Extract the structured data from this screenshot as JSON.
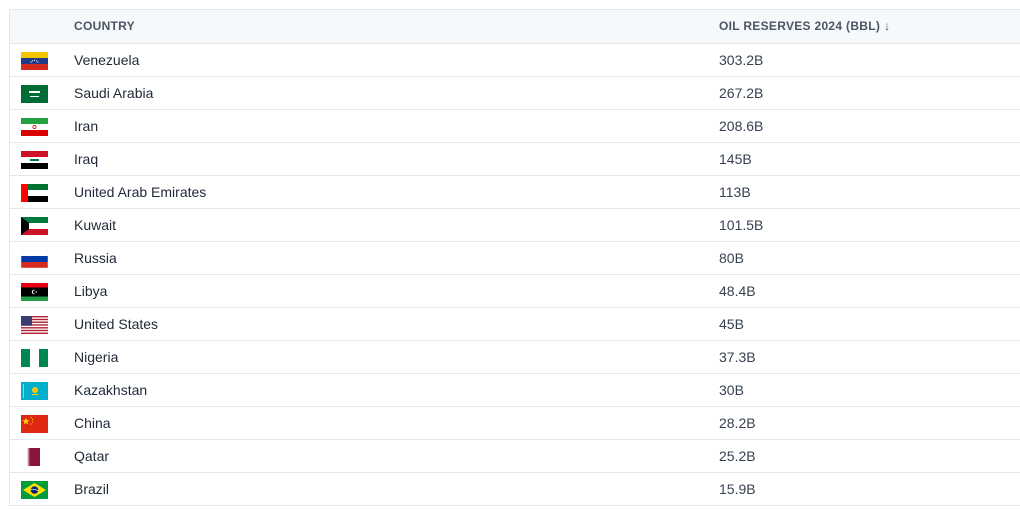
{
  "table": {
    "headers": {
      "country": "COUNTRY",
      "oil_reserves": "OIL RESERVES 2024 (BBL)",
      "sort_icon": "↓"
    },
    "rows": [
      {
        "country": "Venezuela",
        "reserves": "303.2B",
        "flag_icon": "venezuela-flag-icon"
      },
      {
        "country": "Saudi Arabia",
        "reserves": "267.2B",
        "flag_icon": "saudi-arabia-flag-icon"
      },
      {
        "country": "Iran",
        "reserves": "208.6B",
        "flag_icon": "iran-flag-icon"
      },
      {
        "country": "Iraq",
        "reserves": "145B",
        "flag_icon": "iraq-flag-icon"
      },
      {
        "country": "United Arab Emirates",
        "reserves": "113B",
        "flag_icon": "uae-flag-icon"
      },
      {
        "country": "Kuwait",
        "reserves": "101.5B",
        "flag_icon": "kuwait-flag-icon"
      },
      {
        "country": "Russia",
        "reserves": "80B",
        "flag_icon": "russia-flag-icon"
      },
      {
        "country": "Libya",
        "reserves": "48.4B",
        "flag_icon": "libya-flag-icon"
      },
      {
        "country": "United States",
        "reserves": "45B",
        "flag_icon": "united-states-flag-icon"
      },
      {
        "country": "Nigeria",
        "reserves": "37.3B",
        "flag_icon": "nigeria-flag-icon"
      },
      {
        "country": "Kazakhstan",
        "reserves": "30B",
        "flag_icon": "kazakhstan-flag-icon"
      },
      {
        "country": "China",
        "reserves": "28.2B",
        "flag_icon": "china-flag-icon"
      },
      {
        "country": "Qatar",
        "reserves": "25.2B",
        "flag_icon": "qatar-flag-icon"
      },
      {
        "country": "Brazil",
        "reserves": "15.9B",
        "flag_icon": "brazil-flag-icon"
      }
    ]
  }
}
